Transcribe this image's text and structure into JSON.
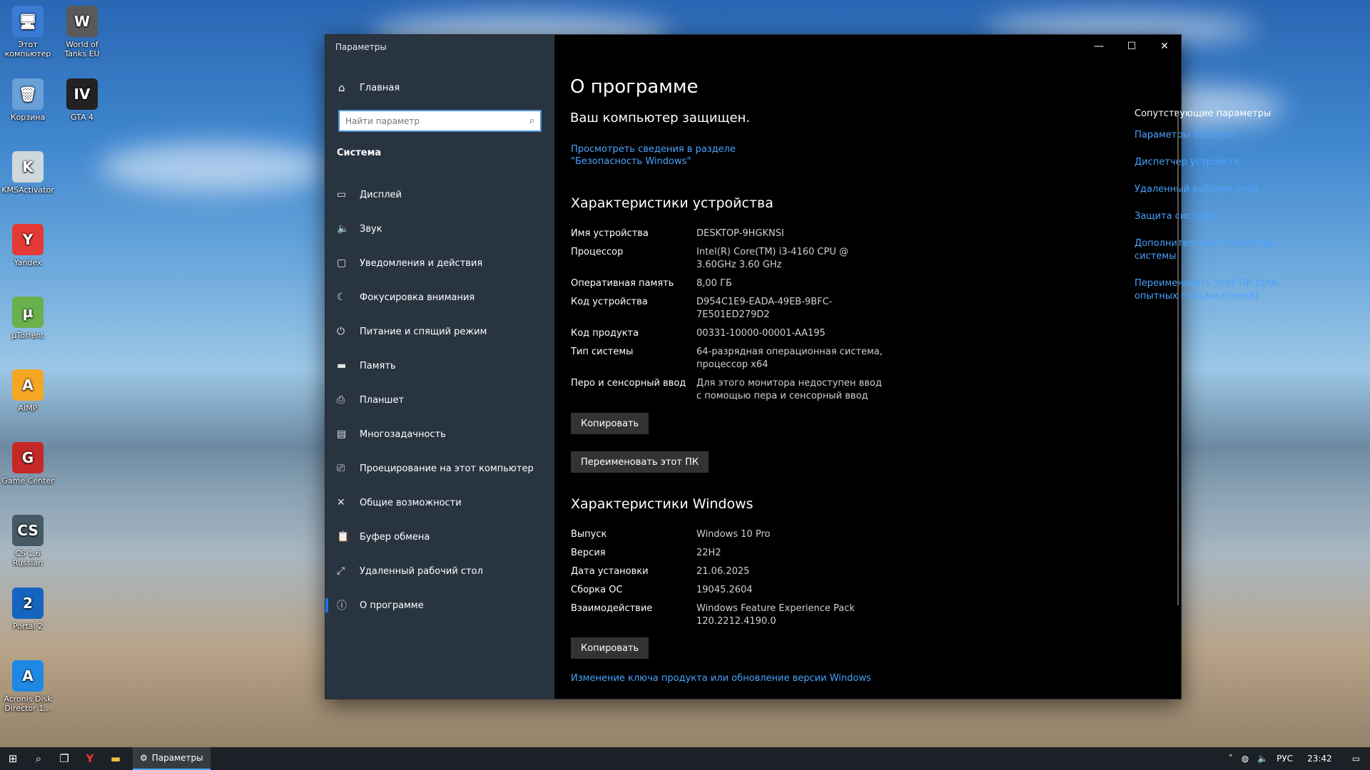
{
  "window": {
    "title": "Параметры",
    "controls": {
      "minimize": "—",
      "maximize": "☐",
      "close": "✕"
    }
  },
  "sidebar": {
    "home_label": "Главная",
    "search_placeholder": "Найти параметр",
    "section_title": "Система",
    "items": [
      {
        "label": "Дисплей",
        "icon": "display-icon"
      },
      {
        "label": "Звук",
        "icon": "sound-icon"
      },
      {
        "label": "Уведомления и действия",
        "icon": "notifications-icon"
      },
      {
        "label": "Фокусировка внимания",
        "icon": "focus-assist-icon"
      },
      {
        "label": "Питание и спящий режим",
        "icon": "power-icon"
      },
      {
        "label": "Память",
        "icon": "storage-icon"
      },
      {
        "label": "Планшет",
        "icon": "tablet-icon"
      },
      {
        "label": "Многозадачность",
        "icon": "multitasking-icon"
      },
      {
        "label": "Проецирование на этот компьютер",
        "icon": "projecting-icon"
      },
      {
        "label": "Общие возможности",
        "icon": "shared-experiences-icon"
      },
      {
        "label": "Буфер обмена",
        "icon": "clipboard-icon"
      },
      {
        "label": "Удаленный рабочий стол",
        "icon": "remote-desktop-icon"
      },
      {
        "label": "О программе",
        "icon": "about-icon"
      }
    ]
  },
  "main": {
    "title": "О программе",
    "protected_text": "Ваш компьютер защищен.",
    "security_link": "Просмотреть сведения в разделе \"Безопасность Windows\"",
    "device_specs_title": "Характеристики устройства",
    "device_specs": [
      {
        "key": "Имя устройства",
        "value": "DESKTOP-9HGKNSI"
      },
      {
        "key": "Процессор",
        "value": "Intel(R) Core(TM) i3-4160 CPU @ 3.60GHz 3.60 GHz"
      },
      {
        "key": "Оперативная память",
        "value": "8,00 ГБ"
      },
      {
        "key": "Код устройства",
        "value": "D954C1E9-EADA-49EB-9BFC-7E501ED279D2"
      },
      {
        "key": "Код продукта",
        "value": "00331-10000-00001-AA195"
      },
      {
        "key": "Тип системы",
        "value": "64-разрядная операционная система, процессор x64"
      },
      {
        "key": "Перо и сенсорный ввод",
        "value": "Для этого монитора недоступен ввод с помощью пера и сенсорный ввод"
      }
    ],
    "copy_button": "Копировать",
    "rename_button": "Переименовать этот ПК",
    "windows_specs_title": "Характеристики Windows",
    "windows_specs": [
      {
        "key": "Выпуск",
        "value": "Windows 10 Pro"
      },
      {
        "key": "Версия",
        "value": "22H2"
      },
      {
        "key": "Дата установки",
        "value": "21.06.2025"
      },
      {
        "key": "Сборка ОС",
        "value": "19045.2604"
      },
      {
        "key": "Взаимодействие",
        "value": "Windows Feature Experience Pack 120.2212.4190.0"
      }
    ],
    "copy_button_2": "Копировать",
    "product_key_link": "Изменение ключа продукта или обновление версии Windows"
  },
  "related": {
    "title": "Сопутствующие параметры",
    "links": [
      "Параметры BitLocker",
      "Диспетчер устройств",
      "Удаленный рабочий стол",
      "Защита системы",
      "Дополнительные параметры системы",
      "Переименовать этот ПК (для опытных пользователей)"
    ]
  },
  "desktop_icons": [
    {
      "label": "Этот компьютер",
      "icon": "this-pc-icon",
      "glyph": "🖥"
    },
    {
      "label": "World of Tanks EU",
      "icon": "world-of-tanks-icon",
      "glyph": "W"
    },
    {
      "label": "Корзина",
      "icon": "recycle-bin-icon",
      "glyph": "🗑"
    },
    {
      "label": "GTA 4",
      "icon": "gta4-icon",
      "glyph": "IV"
    },
    {
      "label": "KMSActivator",
      "icon": "kmsactivator-icon",
      "glyph": "K"
    },
    {
      "label": "Yandex",
      "icon": "yandex-icon",
      "glyph": "Y"
    },
    {
      "label": "µTorrent",
      "icon": "utorrent-icon",
      "glyph": "µ"
    },
    {
      "label": "AIMP",
      "icon": "aimp-icon",
      "glyph": "A"
    },
    {
      "label": "Game Center",
      "icon": "game-center-icon",
      "glyph": "G"
    },
    {
      "label": "CS 1.6 Russian",
      "icon": "cs16-icon",
      "glyph": "CS"
    },
    {
      "label": "Portal 2",
      "icon": "portal2-icon",
      "glyph": "2"
    },
    {
      "label": "Acronis Disk Director 1...",
      "icon": "acronis-icon",
      "glyph": "A"
    }
  ],
  "taskbar": {
    "active_app": "Параметры",
    "language": "РУС",
    "time": "23:42"
  },
  "colors": {
    "accent": "#1a73e8",
    "link": "#4aa3ff",
    "window_bg": "#000000",
    "sidebar_bg": "#2c3846"
  }
}
